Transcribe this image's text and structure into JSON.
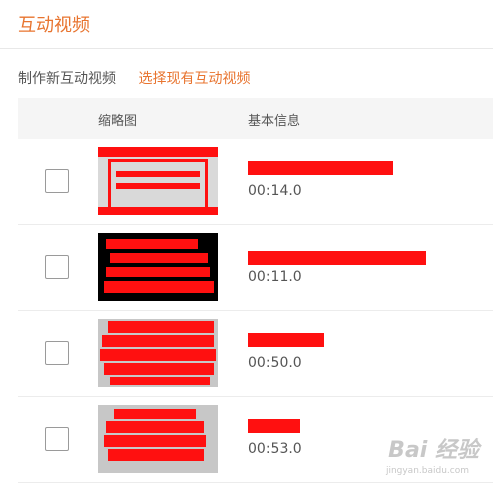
{
  "header": {
    "title": "互动视频"
  },
  "tabs": [
    {
      "label": "制作新互动视频"
    },
    {
      "label": "选择现有互动视频"
    }
  ],
  "table": {
    "columns": [
      "缩略图",
      "基本信息"
    ],
    "rows": [
      {
        "duration": "00:14.0"
      },
      {
        "duration": "00:11.0"
      },
      {
        "duration": "00:50.0"
      },
      {
        "duration": "00:53.0"
      }
    ]
  },
  "watermark": {
    "logo": "Bai 经验",
    "url": "jingyan.baidu.com"
  },
  "colors": {
    "accent": "#e8742f",
    "redaction": "#ff1010",
    "header_bg": "#f5f5f5"
  }
}
